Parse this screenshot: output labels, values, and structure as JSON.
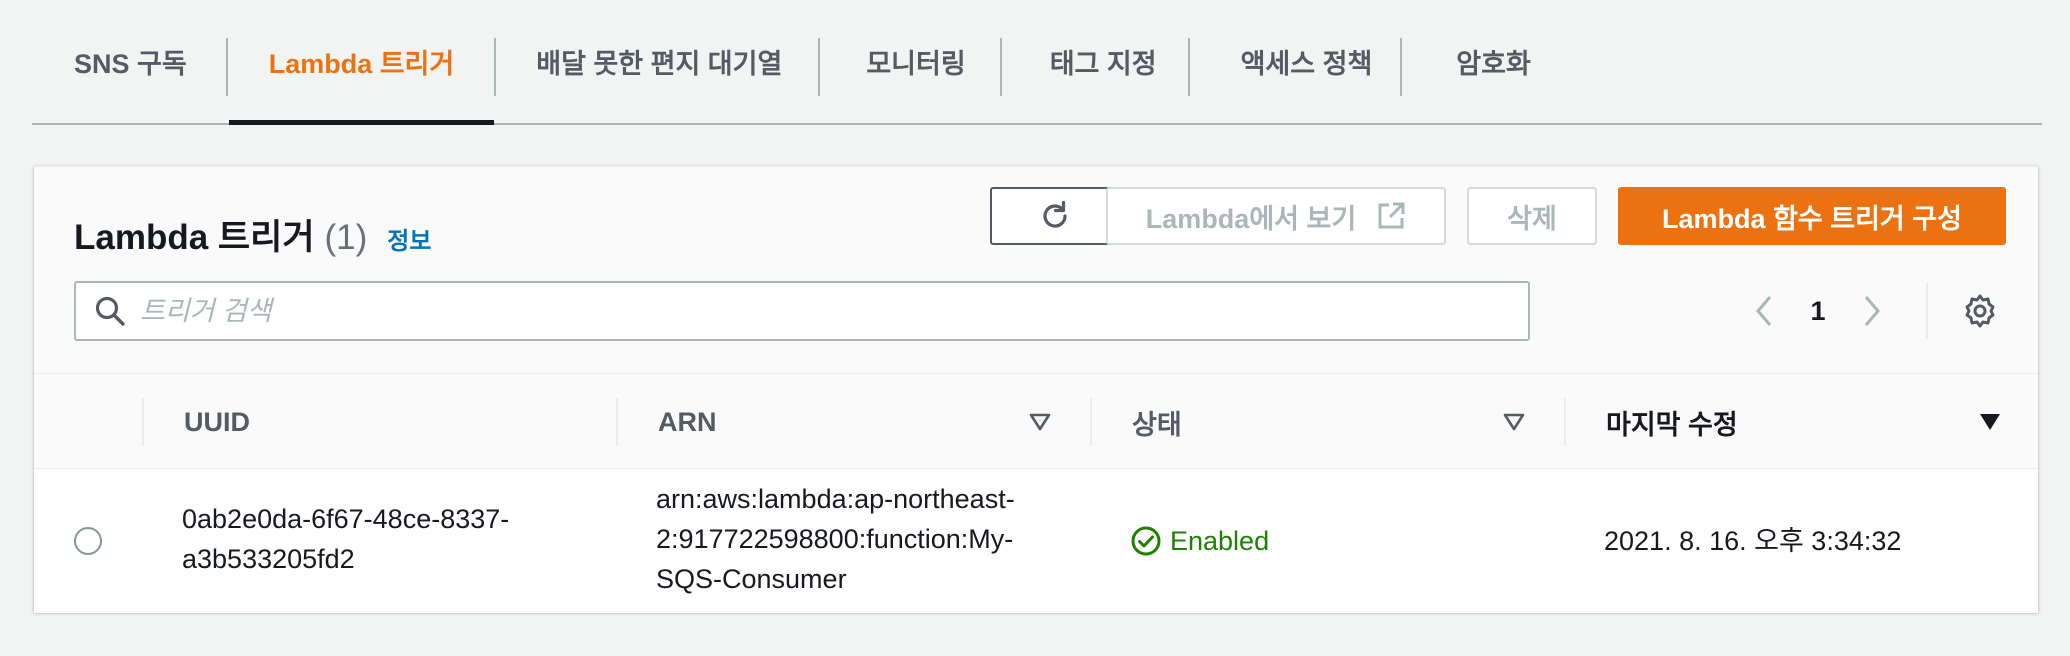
{
  "tabs": [
    {
      "label": "SNS 구독"
    },
    {
      "label": "Lambda 트리거"
    },
    {
      "label": "배달 못한 편지 대기열"
    },
    {
      "label": "모니터링"
    },
    {
      "label": "태그 지정"
    },
    {
      "label": "액세스 정책"
    },
    {
      "label": "암호화"
    }
  ],
  "active_tab": "Lambda 트리거",
  "panel": {
    "title": "Lambda 트리거",
    "count": "(1)",
    "info_link": "정보",
    "buttons": {
      "view_in_lambda": "Lambda에서 보기",
      "delete": "삭제",
      "configure": "Lambda 함수 트리거 구성"
    },
    "search_placeholder": "트리거 검색",
    "pagination": {
      "current_page": "1"
    }
  },
  "table": {
    "columns": [
      "UUID",
      "ARN",
      "상태",
      "마지막 수정"
    ],
    "rows": [
      {
        "uuid_line1": "0ab2e0da-6f67-48ce-8337-",
        "uuid_line2": "a3b533205fd2",
        "arn_line1": "arn:aws:lambda:ap-northeast-",
        "arn_line2": "2:917722598800:function:My-",
        "arn_line3": "SQS-Consumer",
        "status": "Enabled",
        "last_modified": "2021. 8. 16. 오후 3:34:32"
      }
    ]
  },
  "colors": {
    "accent": "#ec7211",
    "link": "#0073bb",
    "success": "#1d8102",
    "text": "#16191f",
    "muted": "#545b64",
    "background": "#f2f3f3"
  }
}
